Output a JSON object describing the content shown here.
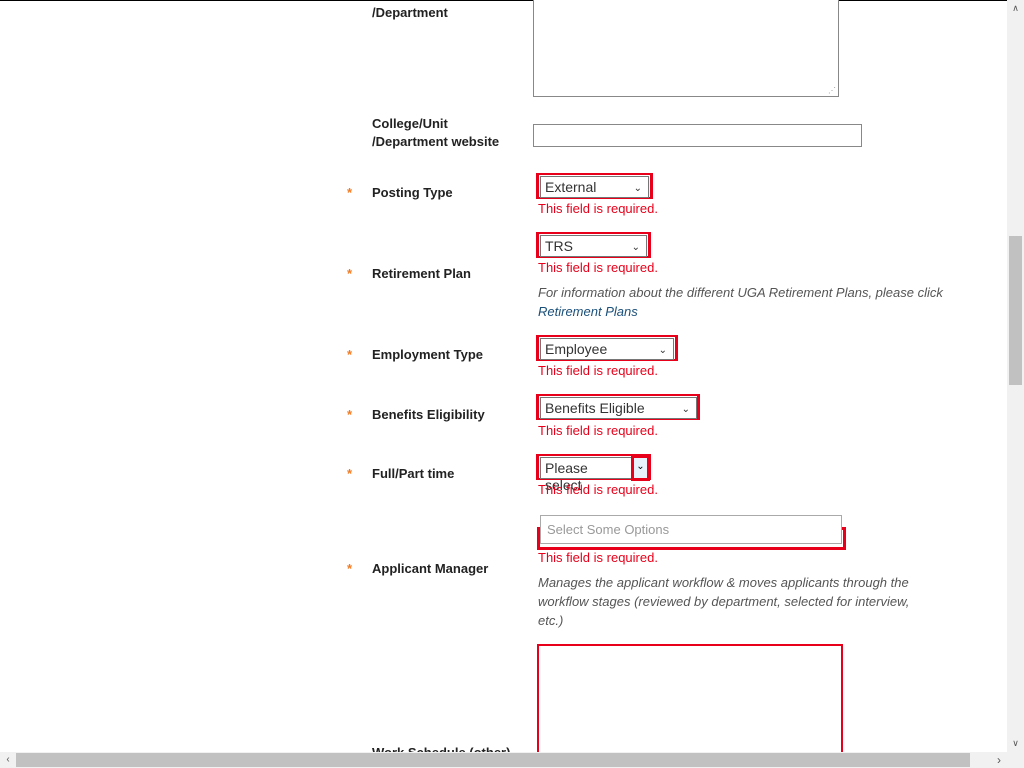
{
  "fields": {
    "department": {
      "label": "/Department"
    },
    "website": {
      "label_line1": "College/Unit",
      "label_line2": "/Department website",
      "value": ""
    },
    "posting_type": {
      "label": "Posting Type",
      "value": "External",
      "error": "This field is required."
    },
    "retirement_plan": {
      "label": "Retirement Plan",
      "value": "TRS",
      "error": "This field is required.",
      "help_text": "For information about the different UGA Retirement Plans, please click ",
      "help_link": "Retirement Plans"
    },
    "employment_type": {
      "label": "Employment Type",
      "value": "Employee",
      "error": "This field is required."
    },
    "benefits": {
      "label": "Benefits Eligibility",
      "value": "Benefits Eligible",
      "error": "This field is required."
    },
    "full_part": {
      "label": "Full/Part time",
      "value": "Please select",
      "error": "This field is required."
    },
    "applicant_manager": {
      "label": "Applicant Manager",
      "placeholder": "Select Some Options",
      "error": "This field is required.",
      "help_text": "Manages the applicant workflow & moves applicants through the workflow stages (reviewed by department, selected for interview, etc.)"
    },
    "work_schedule": {
      "label": "Work Schedule (other)"
    }
  },
  "required_marker": "*",
  "colors": {
    "error": "#e8001a",
    "required": "#f47a20",
    "link": "#1a4f7a"
  }
}
